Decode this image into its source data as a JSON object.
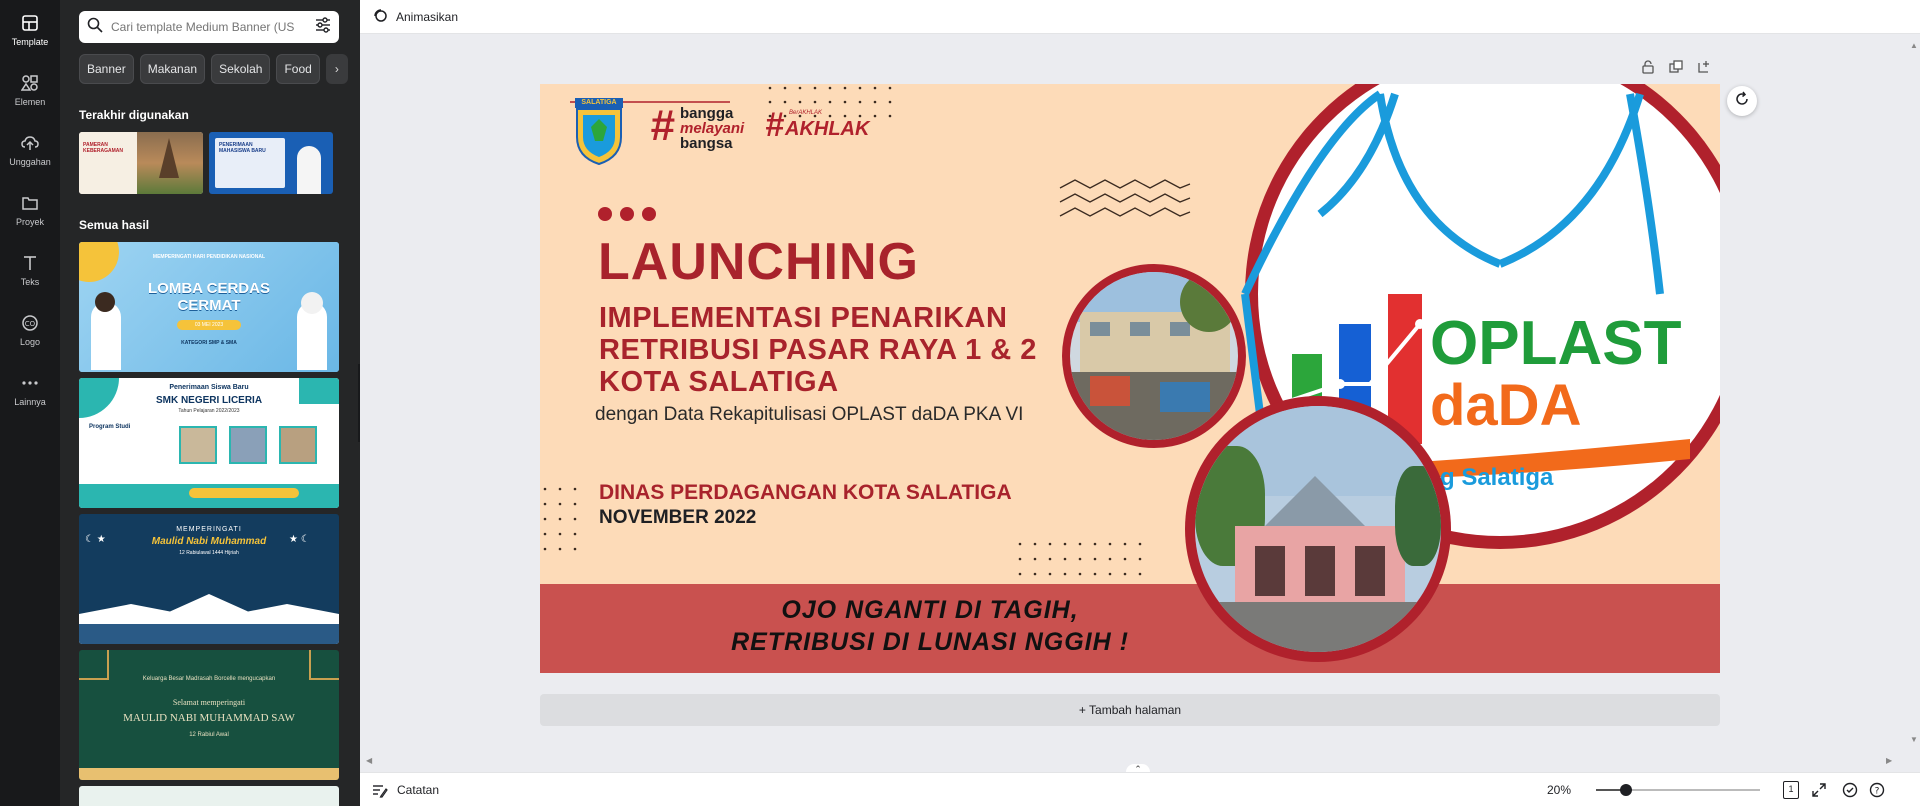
{
  "rail": {
    "items": [
      {
        "label": "Template",
        "icon": "template-icon"
      },
      {
        "label": "Elemen",
        "icon": "elements-icon"
      },
      {
        "label": "Unggahan",
        "icon": "upload-icon"
      },
      {
        "label": "Proyek",
        "icon": "folder-icon"
      },
      {
        "label": "Teks",
        "icon": "text-icon"
      },
      {
        "label": "Logo",
        "icon": "logo-icon"
      },
      {
        "label": "Lainnya",
        "icon": "more-icon"
      }
    ]
  },
  "panel": {
    "search_placeholder": "Cari template Medium Banner (US",
    "chips": [
      "Banner",
      "Makanan",
      "Sekolah",
      "Food"
    ],
    "recent_title": "Terakhir digunakan",
    "all_title": "Semua hasil",
    "recent_thumbs": [
      {
        "text": "PAMERAN KEBERAGAMAN"
      },
      {
        "text": "PENERIMAAN MAHASISWA BARU"
      }
    ],
    "results": [
      {
        "top": "MEMPERINGATI HARI PENDIDIKAN NASIONAL",
        "title": "LOMBA CERDAS CERMAT",
        "date": "03 MEI 2023",
        "sub": "KATEGORI SMP & SMA"
      },
      {
        "top": "Penerimaan Siswa Baru",
        "title": "SMK NEGERI LICERIA",
        "date": "Tahun Pelajaran 2022/2023",
        "sub": "Program Studi"
      },
      {
        "top": "MEMPERINGATI",
        "title": "Maulid Nabi Muhammad",
        "date": "12 Rabiulawal 1444 Hijriah",
        "sub": ""
      },
      {
        "top": "Keluarga Besar Madrasah Borcelle mengucapkan",
        "title": "MAULID NABI MUHAMMAD SAW",
        "date": "Selamat memperingati",
        "sub": "12 Rabiul Awal"
      }
    ]
  },
  "topbar": {
    "animate_label": "Animasikan"
  },
  "design": {
    "logo_city": "SALATIGA",
    "bangga_1": "bangga",
    "bangga_2": "melayani",
    "bangga_3": "bangsa",
    "akhlak": "AKHLAK",
    "akhlak_small": "BerAKHLAK",
    "launching": "LAUNCHING",
    "impl_1": "IMPLEMENTASI PENARIKAN",
    "impl_2": "RETRIBUSI PASAR RAYA 1 & 2",
    "impl_3": "KOTA SALATIGA",
    "subtitle": "dengan Data Rekapitulisasi OPLAST daDA PKA VI",
    "dinas": "DINAS PERDAGANGAN KOTA SALATIGA",
    "month": "NOVEMBER 2022",
    "slogan_1": "OJO NGANTI DI TAGIH,",
    "slogan_2": "RETRIBUSI DI LUNASI NGGIH !",
    "oplast": "OPLAST",
    "dada": "daDA",
    "salatiga_tag": "g Salatiga"
  },
  "add_page_label": "+ Tambah halaman",
  "bottombar": {
    "notes_label": "Catatan",
    "zoom": "20%",
    "zoom_level": 0.18,
    "page_count": "1"
  },
  "colors": {
    "accent": "#b0212c",
    "dark_rail": "#18191b",
    "panel": "#252627",
    "banner_bg": "#fddbb8",
    "oplast_green": "#1f9c3a",
    "oplast_orange": "#f26a1b",
    "oplast_blue": "#1a9bdc"
  }
}
